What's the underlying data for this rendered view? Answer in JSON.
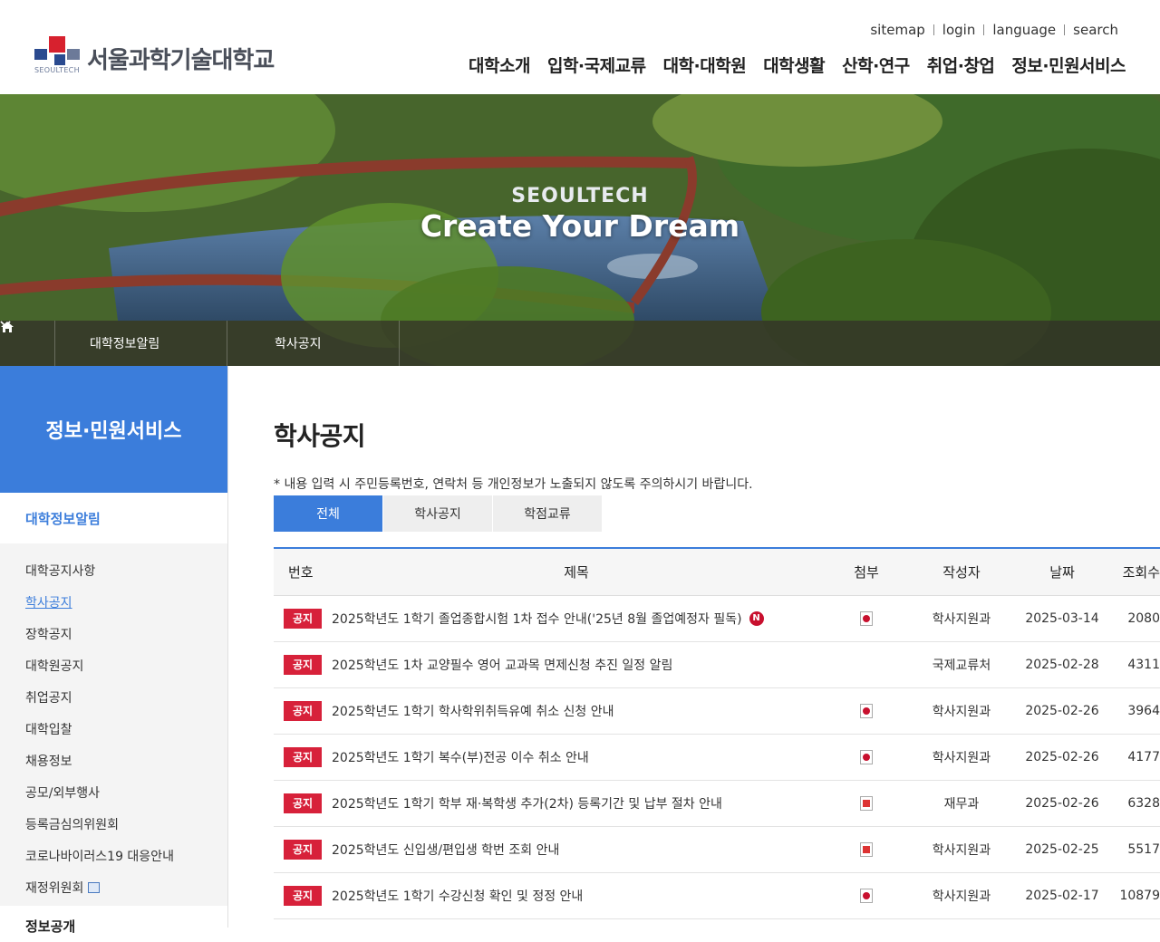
{
  "header": {
    "logo_sub": "SEOULTECH",
    "logo_text": "서울과학기술대학교",
    "util": [
      "sitemap",
      "login",
      "language",
      "search"
    ],
    "gnb": [
      "대학소개",
      "입학·국제교류",
      "대학·대학원",
      "대학생활",
      "산학·연구",
      "취업·창업",
      "정보·민원서비스"
    ]
  },
  "hero": {
    "subtitle": "SEOULTECH",
    "title": "Create Your Dream"
  },
  "location": {
    "home_icon": "home-icon",
    "level1": "대학정보알림",
    "level2": "학사공지"
  },
  "sidebar": {
    "heading": "정보·민원서비스",
    "category": "대학정보알림",
    "items": [
      {
        "label": "대학공지사항"
      },
      {
        "label": "학사공지"
      },
      {
        "label": "장학공지"
      },
      {
        "label": "대학원공지"
      },
      {
        "label": "취업공지"
      },
      {
        "label": "대학입찰"
      },
      {
        "label": "채용정보"
      },
      {
        "label": "공모/외부행사"
      },
      {
        "label": "등록금심의위원회"
      },
      {
        "label": "코로나바이러스19 대응안내"
      },
      {
        "label": "재정위원회"
      }
    ],
    "next_category": "정보공개"
  },
  "main": {
    "title": "학사공지",
    "notice": "* 내용 입력 시 주민등록번호, 연락처 등 개인정보가 노출되지 않도록 주의하시기 바랍니다.",
    "tabs": [
      "전체",
      "학사공지",
      "학점교류"
    ],
    "table": {
      "headers": [
        "번호",
        "제목",
        "첨부",
        "작성자",
        "날짜",
        "조회수"
      ],
      "rows": [
        {
          "badge": "공지",
          "title": "2025학년도 1학기 졸업종합시험 1차 접수 안내('25년 8월 졸업예정자 필독)",
          "new": "N",
          "writer": "학사지원과",
          "date": "2025-03-14",
          "views": "2080"
        },
        {
          "badge": "공지",
          "title": "2025학년도 1차 교양필수 영어 교과목 면제신청 추진 일정 알림",
          "new": "",
          "writer": "국제교류처",
          "date": "2025-02-28",
          "views": "4311"
        },
        {
          "badge": "공지",
          "title": "2025학년도 1학기 학사학위취득유예 취소 신청 안내",
          "new": "",
          "writer": "학사지원과",
          "date": "2025-02-26",
          "views": "3964"
        },
        {
          "badge": "공지",
          "title": "2025학년도 1학기 복수(부)전공 이수 취소 안내",
          "new": "",
          "writer": "학사지원과",
          "date": "2025-02-26",
          "views": "4177"
        },
        {
          "badge": "공지",
          "title": "2025학년도 1학기 학부 재·복학생 추가(2차) 등록기간 및 납부 절차 안내",
          "new": "",
          "writer": "재무과",
          "date": "2025-02-26",
          "views": "6328"
        },
        {
          "badge": "공지",
          "title": "2025학년도 신입생/편입생 학번 조회 안내",
          "new": "",
          "writer": "학사지원과",
          "date": "2025-02-25",
          "views": "5517"
        },
        {
          "badge": "공지",
          "title": "2025학년도 1학기 수강신청 확인 및 정정 안내",
          "new": "",
          "writer": "학사지원과",
          "date": "2025-02-17",
          "views": "10879"
        }
      ]
    }
  },
  "colors": {
    "accent": "#3b7ddb",
    "badge": "#d7213a",
    "brand_red": "#d7212e",
    "brand_blue": "#2a4a8f"
  }
}
